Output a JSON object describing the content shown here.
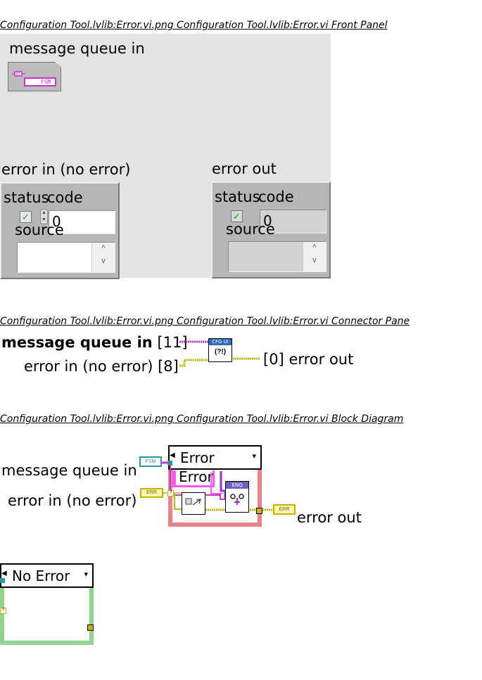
{
  "front_panel": {
    "caption": "Configuration Tool.lvlib:Error.vi.png  Configuration Tool.lvlib:Error.vi Front Panel",
    "message_queue_label": "message queue in",
    "queue_refnum_text": "FSM",
    "error_in": {
      "label": "error in (no error)",
      "status_label": "status",
      "code_label": "code",
      "code_value": "0",
      "source_label": "source",
      "status_check": "✓"
    },
    "error_out": {
      "label": "error out",
      "status_label": "status",
      "code_label": "code",
      "code_value": "0",
      "source_label": "source",
      "status_check": "✓"
    }
  },
  "connector_pane": {
    "caption": "Configuration Tool.lvlib:Error.vi.png  Configuration Tool.lvlib:Error.vi Connector Pane",
    "input1_label": "message queue in",
    "input1_index": "[11]",
    "input2_label": "error in (no error)",
    "input2_index": "[8]",
    "output_index": "[0]",
    "output_label": "error out",
    "icon_banner": "CFG UI",
    "icon_glyph": "(?!)"
  },
  "block_diagram": {
    "caption": "Configuration Tool.lvlib:Error.vi.png  Configuration Tool.lvlib:Error.vi Block Diagram",
    "message_queue_label": "message queue in",
    "error_in_label": "error in (no error)",
    "error_out_label": "error out",
    "case_selector_value": "Error",
    "inner_constant": "Error",
    "queue_terminal_text": "FSM",
    "error_terminal_text": "ERR",
    "subvi_banner": "ENQ",
    "second_case_selector_value": "No Error"
  },
  "colors": {
    "panel_bg": "#e3e3e3",
    "error_wire": "#c4b400",
    "queue_wire": "#cc33cc",
    "string_wire": "#ff55ff",
    "case_border_error": "#e8838a",
    "case_border_noerror": "#8fd58f",
    "refnum": "#cc33cc",
    "teal": "#2a9a9a"
  }
}
